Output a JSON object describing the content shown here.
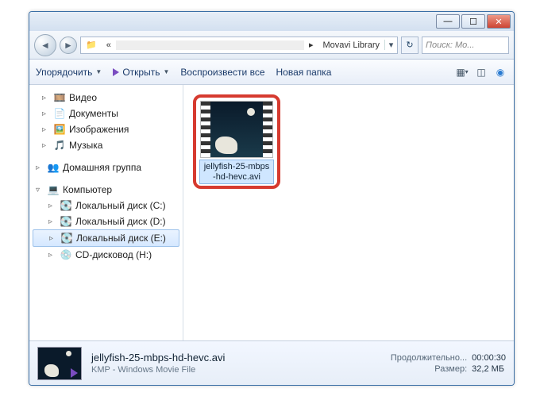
{
  "window": {
    "address_folder": "Movavi Library",
    "search_placeholder": "Поиск: Mo..."
  },
  "toolbar": {
    "organize": "Упорядочить",
    "open": "Открыть",
    "playall": "Воспроизвести все",
    "newfolder": "Новая папка"
  },
  "tree": {
    "video": "Видео",
    "documents": "Документы",
    "pictures": "Изображения",
    "music": "Музыка",
    "homegroup": "Домашняя группа",
    "computer": "Компьютер",
    "disk_c": "Локальный диск (C:)",
    "disk_d": "Локальный диск (D:)",
    "disk_e": "Локальный диск (E:)",
    "cd_h": "CD-дисковод (H:)"
  },
  "file": {
    "label_l1": "jellyfish-25-mbps",
    "label_l2": "-hd-hevc.avi"
  },
  "details": {
    "filename": "jellyfish-25-mbps-hd-hevc.avi",
    "filetype": "KMP - Windows Movie File",
    "duration_label": "Продолжительно...",
    "duration_value": "00:00:30",
    "size_label": "Размер:",
    "size_value": "32,2 МБ"
  }
}
